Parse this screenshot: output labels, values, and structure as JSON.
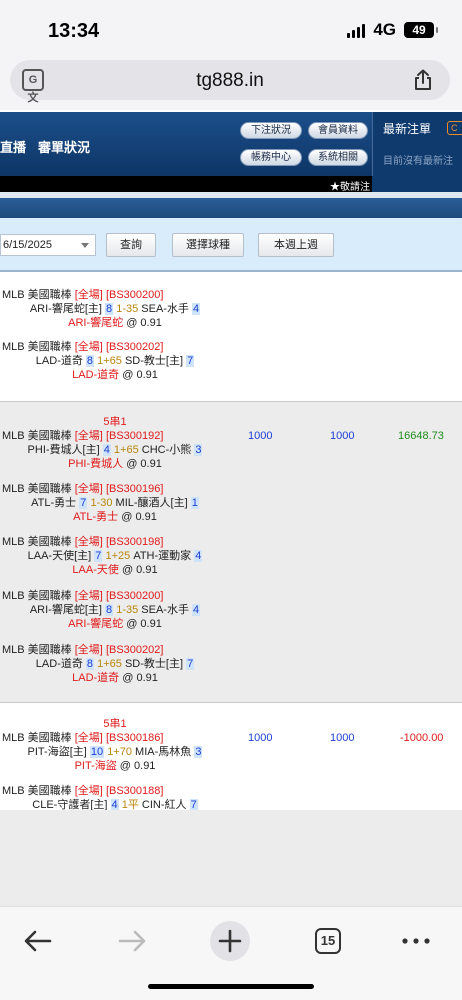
{
  "status_bar": {
    "time": "13:34",
    "network": "4G",
    "battery": "49"
  },
  "browser": {
    "url": "tg888.in",
    "tab_count": "15"
  },
  "header": {
    "nav_live": "直播",
    "nav_review": "審單狀況",
    "buttons": [
      "下注狀況",
      "會員資料",
      "帳務中心",
      "系統相關"
    ],
    "latest_title": "最新注單",
    "latest_tag": "C",
    "latest_empty": "目前沒有最新注",
    "ticker": "★敬請注"
  },
  "filter": {
    "date_value": "6/15/2025",
    "query_label": "查詢",
    "sport_label": "選擇球種",
    "week_label": "本週上週"
  },
  "bets": [
    {
      "combo": "",
      "stake": "",
      "valid": "",
      "result": "",
      "legs": [
        {
          "league": "MLB 美國職棒",
          "market": "[全場]",
          "code": "[BS300200]",
          "home": "ARI-響尾蛇[主]",
          "home_score": "8",
          "line": "1-35",
          "away": "SEA-水手",
          "away_score": "4",
          "pick": "ARI-響尾蛇",
          "odds": "@ 0.91"
        },
        {
          "league": "MLB 美國職棒",
          "market": "[全場]",
          "code": "[BS300202]",
          "home": "LAD-道奇",
          "home_score": "8",
          "line": "1+65",
          "away": "SD-教士[主]",
          "away_score": "7",
          "pick": "LAD-道奇",
          "odds": "@ 0.91"
        }
      ]
    },
    {
      "combo": "5串1",
      "stake": "1000",
      "valid": "1000",
      "result": "16648.73",
      "legs": [
        {
          "league": "MLB 美國職棒",
          "market": "[全場]",
          "code": "[BS300192]",
          "home": "PHI-費城人[主]",
          "home_score": "4",
          "line": "1+65",
          "away": "CHC-小熊",
          "away_score": "3",
          "pick": "PHI-費城人",
          "odds": "@ 0.91"
        },
        {
          "league": "MLB 美國職棒",
          "market": "[全場]",
          "code": "[BS300196]",
          "home": "ATL-勇士",
          "home_score": "7",
          "line": "1-30",
          "away": "MIL-釀酒人[主]",
          "away_score": "1",
          "pick": "ATL-勇士",
          "odds": "@ 0.91"
        },
        {
          "league": "MLB 美國職棒",
          "market": "[全場]",
          "code": "[BS300198]",
          "home": "LAA-天使[主]",
          "home_score": "7",
          "line": "1+25",
          "away": "ATH-運動家",
          "away_score": "4",
          "pick": "LAA-天使",
          "odds": "@ 0.91"
        },
        {
          "league": "MLB 美國職棒",
          "market": "[全場]",
          "code": "[BS300200]",
          "home": "ARI-響尾蛇[主]",
          "home_score": "8",
          "line": "1-35",
          "away": "SEA-水手",
          "away_score": "4",
          "pick": "ARI-響尾蛇",
          "odds": "@ 0.91"
        },
        {
          "league": "MLB 美國職棒",
          "market": "[全場]",
          "code": "[BS300202]",
          "home": "LAD-道奇",
          "home_score": "8",
          "line": "1+65",
          "away": "SD-教士[主]",
          "away_score": "7",
          "pick": "LAD-道奇",
          "odds": "@ 0.91"
        }
      ]
    },
    {
      "combo": "5串1",
      "stake": "1000",
      "valid": "1000",
      "result": "-1000.00",
      "legs": [
        {
          "league": "MLB 美國職棒",
          "market": "[全場]",
          "code": "[BS300186]",
          "home": "PIT-海盜[主]",
          "home_score": "10",
          "line": "1+70",
          "away": "MIA-馬林魚",
          "away_score": "3",
          "pick": "PIT-海盜",
          "odds": "@ 0.91"
        },
        {
          "league": "MLB 美國職棒",
          "market": "[全場]",
          "code": "[BS300188]",
          "home": "CLE-守護者[主]",
          "home_score": "4",
          "line": "1平",
          "away": "CIN-紅人",
          "away_score": "7",
          "pick": "",
          "odds": ""
        }
      ]
    }
  ],
  "toolbar": {
    "back": "back",
    "forward": "forward",
    "new_tab": "new-tab",
    "tabs": "15",
    "more": "more"
  }
}
